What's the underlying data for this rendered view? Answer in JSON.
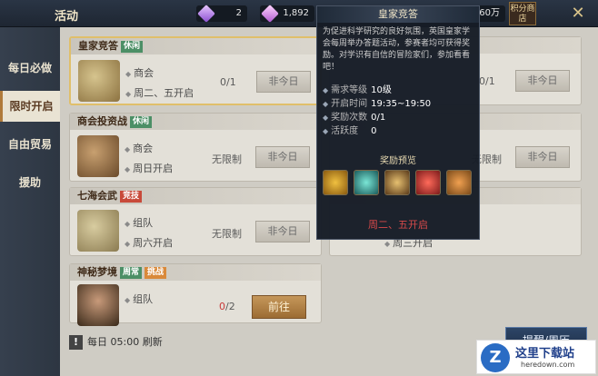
{
  "header": {
    "title": "活动",
    "diamond_count": "2",
    "gem_count": "1,892",
    "gold_count": "60万",
    "shop_label": "积分商店",
    "close_icon": "close-x-icon"
  },
  "sidebar": {
    "items": [
      {
        "label": "每日必做",
        "active": false
      },
      {
        "label": "限时开启",
        "active": true
      },
      {
        "label": "自由贸易",
        "active": false
      },
      {
        "label": "援助",
        "active": false
      }
    ]
  },
  "cards": [
    {
      "title": "皇家竞答",
      "badge": "休闲",
      "badge_color": "#4c8f66",
      "line1": "商会",
      "line2": "周二、五开启",
      "count_current": "0",
      "count_total": "/1",
      "button": "非今日"
    },
    {
      "title": "商会投资战",
      "badge": "休闲",
      "badge_color": "#4c8f66",
      "line1": "商会",
      "line2": "周日开启",
      "count": "无限制",
      "button": "非今日"
    },
    {
      "title": "七海会武",
      "badge": "竞技",
      "badge_color": "#c84a3a",
      "line1": "组队",
      "line2": "周六开启",
      "count": "无限制",
      "button": "非今日"
    },
    {
      "title": "神秘梦境",
      "badge": "周常",
      "badge2": "挑战",
      "badge_color": "#4c8f66",
      "line1": "组队",
      "count_current": "0",
      "count_total": "/2",
      "button": "前往"
    }
  ],
  "right_cards": [
    {
      "count": "0/1",
      "button": "非今日"
    },
    {
      "count": "无限制",
      "button": "非今日"
    },
    {
      "line2": "周三开启"
    }
  ],
  "footer": {
    "warn_icon": "!",
    "text": "每日 05:00 刷新",
    "reward_button": "提醒/周历"
  },
  "popup": {
    "title": "皇家竞答",
    "description": "为促进科学研究的良好氛围，英国皇家学会每周举办答题活动，参赛者均可获得奖励。对学识有自信的冒险家们，参加看看吧！",
    "rows": [
      {
        "key": "需求等级",
        "value": "10级"
      },
      {
        "key": "开启时间",
        "value": "19:35~19:50"
      },
      {
        "key": "奖励次数",
        "value": "0/1"
      },
      {
        "key": "活跃度",
        "value": "0"
      }
    ],
    "preview_label": "奖励预览",
    "items": [
      "gold-coin-icon",
      "teal-gem-icon",
      "scroll-icon",
      "red-cross-icon",
      "orange-medal-icon"
    ],
    "footer": "周二、五开启"
  },
  "watermark": {
    "logo": "Z",
    "name": "这里下载站",
    "url": "heredown.com"
  }
}
